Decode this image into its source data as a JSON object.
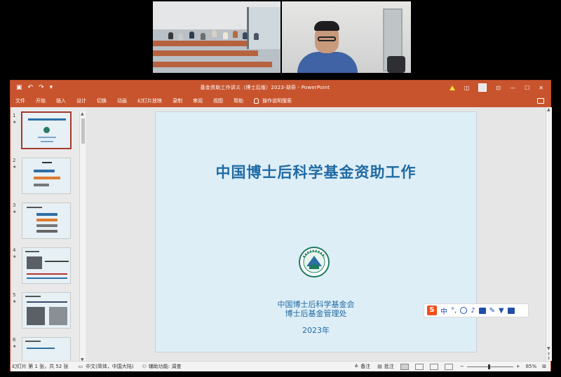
{
  "app": {
    "window_title": "基金资助工作讲义（博士后版）2023-胡奇  -  PowerPoint",
    "colors": {
      "accent": "#c8542d",
      "slide_text": "#1f6aa3",
      "slide_bg": "#deeef7"
    }
  },
  "quick_access": {
    "save_icon": "save-icon",
    "undo_icon": "undo-icon",
    "redo_icon": "redo-icon",
    "customize_icon": "customize-icon"
  },
  "ribbon": {
    "tabs": [
      "文件",
      "开始",
      "插入",
      "设计",
      "切换",
      "动画",
      "幻灯片放映",
      "录制",
      "审阅",
      "视图",
      "帮助"
    ],
    "search_label": "操作说明搜索"
  },
  "thumbnails": {
    "numbers": [
      "1",
      "2",
      "3",
      "4",
      "5",
      "6"
    ],
    "selected": 1,
    "thumb4_title": "中国博士后科学基金资助"
  },
  "slide": {
    "title": "中国博士后科学基金资助工作",
    "org_name": "中国博士后科学基金会",
    "org_dept": "博士后基金管理处",
    "year": "2023年"
  },
  "ime": {
    "logo": "S",
    "mode": "中",
    "punct": "°,"
  },
  "status": {
    "slide_position": "幻灯片 第 1 张，共 52 张",
    "language": "中文(简体，中国大陆)",
    "accessibility": "辅助功能: 调查",
    "notes": "备注",
    "comments": "批注",
    "zoom": "85%",
    "zoom_minus": "−",
    "zoom_plus": "+"
  }
}
